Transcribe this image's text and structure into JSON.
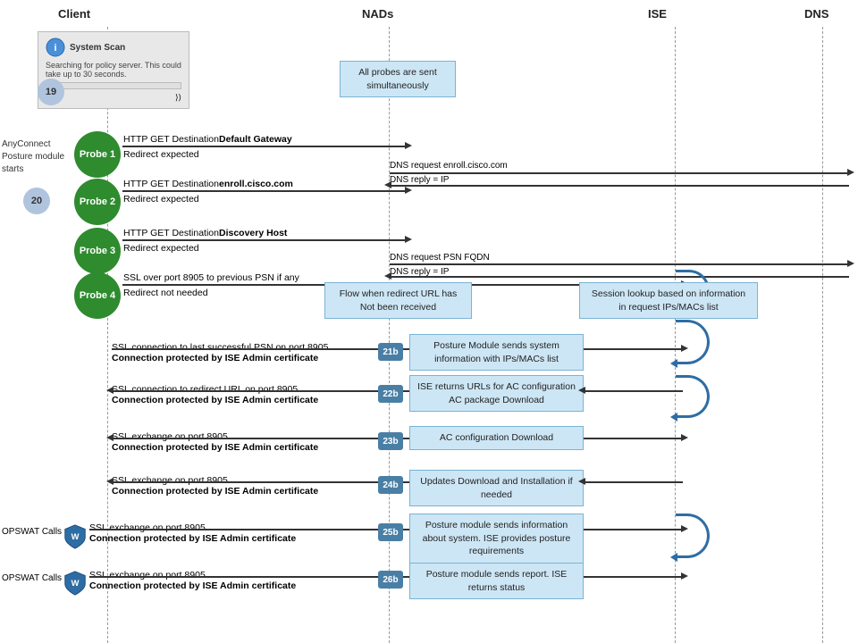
{
  "headers": {
    "client": "Client",
    "nads": "NADs",
    "ise": "ISE",
    "dns": "DNS"
  },
  "anyconnect": {
    "label": "AnyConnect\nPosture module\nstarts"
  },
  "scan_box": {
    "title": "System Scan",
    "subtitle": "Searching for policy server.\nThis could take up to 30 seconds."
  },
  "number20": "20",
  "probes": [
    {
      "id": "probe1",
      "label": "Probe 1",
      "arrow_label": "HTTP GET Destination",
      "arrow_bold": "Default Gateway",
      "sub_label": "Redirect expected"
    },
    {
      "id": "probe2",
      "label": "Probe 2",
      "arrow_label": "HTTP GET Destination",
      "arrow_bold": "enroll.cisco.com",
      "sub_label": "Redirect expected"
    },
    {
      "id": "probe3",
      "label": "Probe 3",
      "arrow_label": "HTTP GET Destination",
      "arrow_bold": "Discovery Host",
      "sub_label": "Redirect expected"
    },
    {
      "id": "probe4",
      "label": "Probe 4",
      "arrow_label": "SSL over port 8905 to previous PSN if any",
      "sub_label": "Redirect not needed"
    }
  ],
  "all_probes_box": "All probes are sent\nsimultaneously",
  "dns_req1": "DNS request enroll.cisco.com",
  "dns_rep1": "DNS reply = IP",
  "dns_req2": "DNS request PSN FQDN",
  "dns_rep2": "DNS reply = IP",
  "flow_box": "Flow when  redirect URL\nhas Not been received",
  "session_lookup_box": "Session lookup based on\ninformation in request IPs/MACs list",
  "steps": [
    {
      "id": "21b",
      "arrow_label": "SSL connection to last successful PSN  on port 8905",
      "arrow_bold2": "Connection  protected by ISE Admin certificate",
      "box": "Posture Module sends system information\nwith IPs/MACs list",
      "direction": "right"
    },
    {
      "id": "22b",
      "arrow_label": "SSL connection to redirect URL on port 8905",
      "arrow_bold2": "Connection  protected by ISE Admin certificate",
      "box": "ISE returns URLs for AC configuration\nAC package Download",
      "direction": "left"
    },
    {
      "id": "23b",
      "arrow_label": "SSL exchange on port 8905",
      "arrow_bold2": "Connection  protected by ISE Admin certificate",
      "box": "AC configuration Download",
      "direction": "left"
    },
    {
      "id": "24b",
      "arrow_label": "SSL exchange on port 8905",
      "arrow_bold2": "Connection  protected by ISE Admin certificate",
      "box": "Updates Download and Installation if needed",
      "direction": "left"
    },
    {
      "id": "25b",
      "arrow_label": "SSL exchange on port 8905",
      "arrow_bold2": "Connection  protected by ISE Admin certificate",
      "box": "Posture module sends information about\nsystem. ISE provides posture requirements",
      "direction": "right",
      "opswat": true,
      "opswat_label": "OPSWAT Calls"
    },
    {
      "id": "26b",
      "arrow_label": "SSL exchange on port 8905",
      "arrow_bold2": "Connection  protected by ISE Admin certificate",
      "box": "Posture module sends report.\nISE returns status",
      "direction": "right",
      "opswat": true,
      "opswat_label": "OPSWAT Calls"
    }
  ]
}
